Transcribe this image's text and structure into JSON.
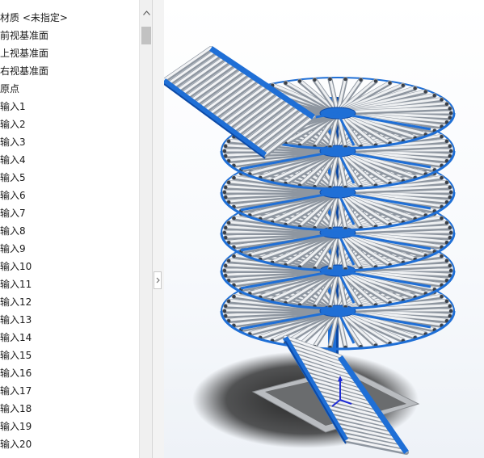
{
  "feature_tree": {
    "items": [
      {
        "label": "材质 <未指定>",
        "icon": "material-icon"
      },
      {
        "label": "前视基准面",
        "icon": "plane-icon"
      },
      {
        "label": "上视基准面",
        "icon": "plane-icon"
      },
      {
        "label": "右视基准面",
        "icon": "plane-icon"
      },
      {
        "label": "原点",
        "icon": "origin-icon"
      },
      {
        "label": "输入1",
        "icon": "imported-body-icon"
      },
      {
        "label": "输入2",
        "icon": "imported-body-icon"
      },
      {
        "label": "输入3",
        "icon": "imported-body-icon"
      },
      {
        "label": "输入4",
        "icon": "imported-body-icon"
      },
      {
        "label": "输入5",
        "icon": "imported-body-icon"
      },
      {
        "label": "输入6",
        "icon": "imported-body-icon"
      },
      {
        "label": "输入7",
        "icon": "imported-body-icon"
      },
      {
        "label": "输入8",
        "icon": "imported-body-icon"
      },
      {
        "label": "输入9",
        "icon": "imported-body-icon"
      },
      {
        "label": "输入10",
        "icon": "imported-body-icon"
      },
      {
        "label": "输入11",
        "icon": "imported-body-icon"
      },
      {
        "label": "输入12",
        "icon": "imported-body-icon"
      },
      {
        "label": "输入13",
        "icon": "imported-body-icon"
      },
      {
        "label": "输入14",
        "icon": "imported-body-icon"
      },
      {
        "label": "输入15",
        "icon": "imported-body-icon"
      },
      {
        "label": "输入16",
        "icon": "imported-body-icon"
      },
      {
        "label": "输入17",
        "icon": "imported-body-icon"
      },
      {
        "label": "输入18",
        "icon": "imported-body-icon"
      },
      {
        "label": "输入19",
        "icon": "imported-body-icon"
      },
      {
        "label": "输入20",
        "icon": "imported-body-icon"
      }
    ]
  },
  "viewport": {
    "model": "spiral-roller-conveyor",
    "colors": {
      "frame": "#1f6fd6",
      "frame_dark": "#0d4aa6",
      "roller": "#d9dde2",
      "roller_shade": "#8e96a0",
      "shadow": "#1c1c1c",
      "base_plate": "#b9bcc0",
      "axis_z": "#1d2bd6"
    }
  },
  "icons": {
    "scroll_up": "chevron-up-icon",
    "splitter": "chevron-right-icon",
    "triad": "coordinate-triad-icon"
  }
}
